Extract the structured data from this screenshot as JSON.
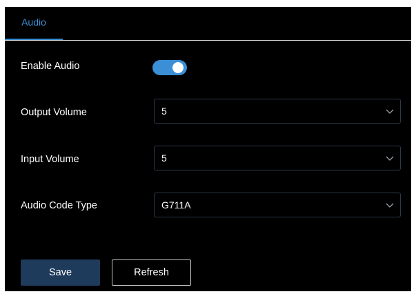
{
  "tabs": [
    {
      "label": "Audio",
      "active": true
    }
  ],
  "settings": {
    "enable_audio": {
      "label": "Enable Audio",
      "on": true
    },
    "output_volume": {
      "label": "Output Volume",
      "value": "5"
    },
    "input_volume": {
      "label": "Input Volume",
      "value": "5"
    },
    "audio_code_type": {
      "label": "Audio Code Type",
      "value": "G711A"
    }
  },
  "buttons": {
    "save": "Save",
    "refresh": "Refresh"
  },
  "colors": {
    "accent": "#3a8fd6",
    "save_bg": "#1f3b5c",
    "panel_bg": "#000000"
  },
  "icons": {
    "dropdown": "chevron-down-icon"
  }
}
